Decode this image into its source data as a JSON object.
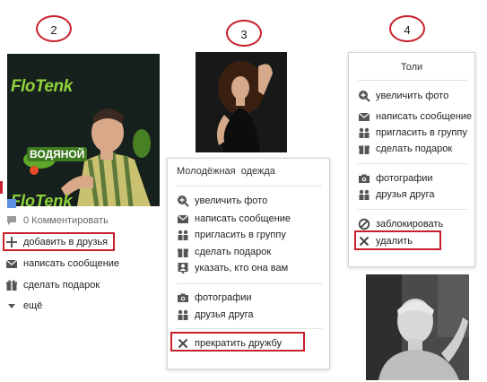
{
  "markers": [
    "2",
    "3",
    "4"
  ],
  "panel2": {
    "logo_text_top": "FloTenk",
    "logo_text_mid": "ВОДЯНОЙ",
    "logo_text_bottom": "FloTenk",
    "comments": "0 Комментировать",
    "actions": [
      "добавить в друзья",
      "написать сообщение",
      "сделать подарок",
      "ещё"
    ]
  },
  "panel3": {
    "title_word1": "Молодёжная",
    "title_word2": "одежда",
    "group1": [
      "увеличить фото",
      "написать сообщение",
      "пригласить в группу",
      "сделать подарок",
      "указать, кто она вам"
    ],
    "group2": [
      "фотографии",
      "друзья друга"
    ],
    "group3": [
      "прекратить дружбу"
    ]
  },
  "panel4": {
    "title": "Толи",
    "group1": [
      "увеличить фото",
      "написать сообщение",
      "пригласить в группу",
      "сделать подарок"
    ],
    "group2": [
      "фотографии",
      "друзья друга"
    ],
    "group3": [
      "заблокировать",
      "удалить"
    ]
  },
  "colors": {
    "highlight_red": "#c8202a",
    "icon_gray": "#555555",
    "logo_green": "#6cc12a"
  }
}
